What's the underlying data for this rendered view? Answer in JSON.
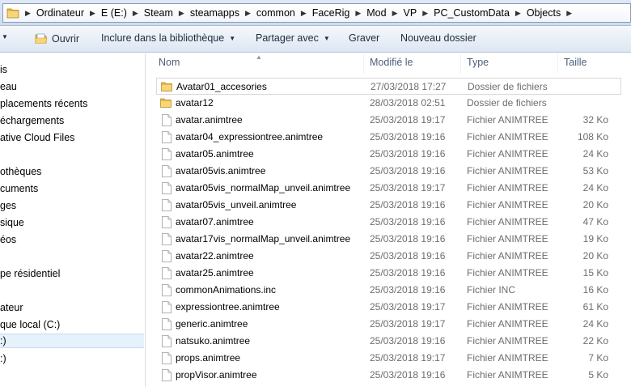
{
  "address_bar": {
    "crumbs": [
      "Ordinateur",
      "E (E:)",
      "Steam",
      "steamapps",
      "common",
      "FaceRig",
      "Mod",
      "VP",
      "PC_CustomData",
      "Objects"
    ]
  },
  "toolbar": {
    "open_label": "Ouvrir",
    "include_label": "Inclure dans la bibliothèque",
    "share_label": "Partager avec",
    "burn_label": "Graver",
    "new_folder_label": "Nouveau dossier",
    "dropdown_icon": "chevron-down-icon"
  },
  "nav": {
    "items": [
      "is",
      "eau",
      "placements récents",
      "échargements",
      "ative Cloud Files",
      "othèques",
      "cuments",
      "ges",
      "sique",
      "éos",
      "pe résidentiel",
      "ateur",
      "que local (C:)",
      ":)",
      ":)"
    ]
  },
  "columns": {
    "name": "Nom",
    "modified": "Modifié le",
    "type": "Type",
    "size": "Taille"
  },
  "files": [
    {
      "name": "Avatar01_accesories",
      "date": "27/03/2018 17:27",
      "type": "Dossier de fichiers",
      "size": "",
      "icon": "folder-icon"
    },
    {
      "name": "avatar12",
      "date": "28/03/2018 02:51",
      "type": "Dossier de fichiers",
      "size": "",
      "icon": "folder-icon"
    },
    {
      "name": "avatar.animtree",
      "date": "25/03/2018 19:17",
      "type": "Fichier ANIMTREE",
      "size": "32 Ko",
      "icon": "file-icon"
    },
    {
      "name": "avatar04_expressiontree.animtree",
      "date": "25/03/2018 19:16",
      "type": "Fichier ANIMTREE",
      "size": "108 Ko",
      "icon": "file-icon"
    },
    {
      "name": "avatar05.animtree",
      "date": "25/03/2018 19:16",
      "type": "Fichier ANIMTREE",
      "size": "24 Ko",
      "icon": "file-icon"
    },
    {
      "name": "avatar05vis.animtree",
      "date": "25/03/2018 19:16",
      "type": "Fichier ANIMTREE",
      "size": "53 Ko",
      "icon": "file-icon"
    },
    {
      "name": "avatar05vis_normalMap_unveil.animtree",
      "date": "25/03/2018 19:17",
      "type": "Fichier ANIMTREE",
      "size": "24 Ko",
      "icon": "file-icon"
    },
    {
      "name": "avatar05vis_unveil.animtree",
      "date": "25/03/2018 19:16",
      "type": "Fichier ANIMTREE",
      "size": "20 Ko",
      "icon": "file-icon"
    },
    {
      "name": "avatar07.animtree",
      "date": "25/03/2018 19:16",
      "type": "Fichier ANIMTREE",
      "size": "47 Ko",
      "icon": "file-icon"
    },
    {
      "name": "avatar17vis_normalMap_unveil.animtree",
      "date": "25/03/2018 19:16",
      "type": "Fichier ANIMTREE",
      "size": "19 Ko",
      "icon": "file-icon"
    },
    {
      "name": "avatar22.animtree",
      "date": "25/03/2018 19:16",
      "type": "Fichier ANIMTREE",
      "size": "20 Ko",
      "icon": "file-icon"
    },
    {
      "name": "avatar25.animtree",
      "date": "25/03/2018 19:16",
      "type": "Fichier ANIMTREE",
      "size": "15 Ko",
      "icon": "file-icon"
    },
    {
      "name": "commonAnimations.inc",
      "date": "25/03/2018 19:16",
      "type": "Fichier INC",
      "size": "16 Ko",
      "icon": "file-icon"
    },
    {
      "name": "expressiontree.animtree",
      "date": "25/03/2018 19:17",
      "type": "Fichier ANIMTREE",
      "size": "61 Ko",
      "icon": "file-icon"
    },
    {
      "name": "generic.animtree",
      "date": "25/03/2018 19:17",
      "type": "Fichier ANIMTREE",
      "size": "24 Ko",
      "icon": "file-icon"
    },
    {
      "name": "natsuko.animtree",
      "date": "25/03/2018 19:16",
      "type": "Fichier ANIMTREE",
      "size": "22 Ko",
      "icon": "file-icon"
    },
    {
      "name": "props.animtree",
      "date": "25/03/2018 19:17",
      "type": "Fichier ANIMTREE",
      "size": "7 Ko",
      "icon": "file-icon"
    },
    {
      "name": "propVisor.animtree",
      "date": "25/03/2018 19:16",
      "type": "Fichier ANIMTREE",
      "size": "5 Ko",
      "icon": "file-icon"
    }
  ],
  "colors": {
    "folder": "#e8b745",
    "selection": "#e5f1fb",
    "header_text": "#4c607a",
    "secondary_text": "#6d6d6d"
  }
}
